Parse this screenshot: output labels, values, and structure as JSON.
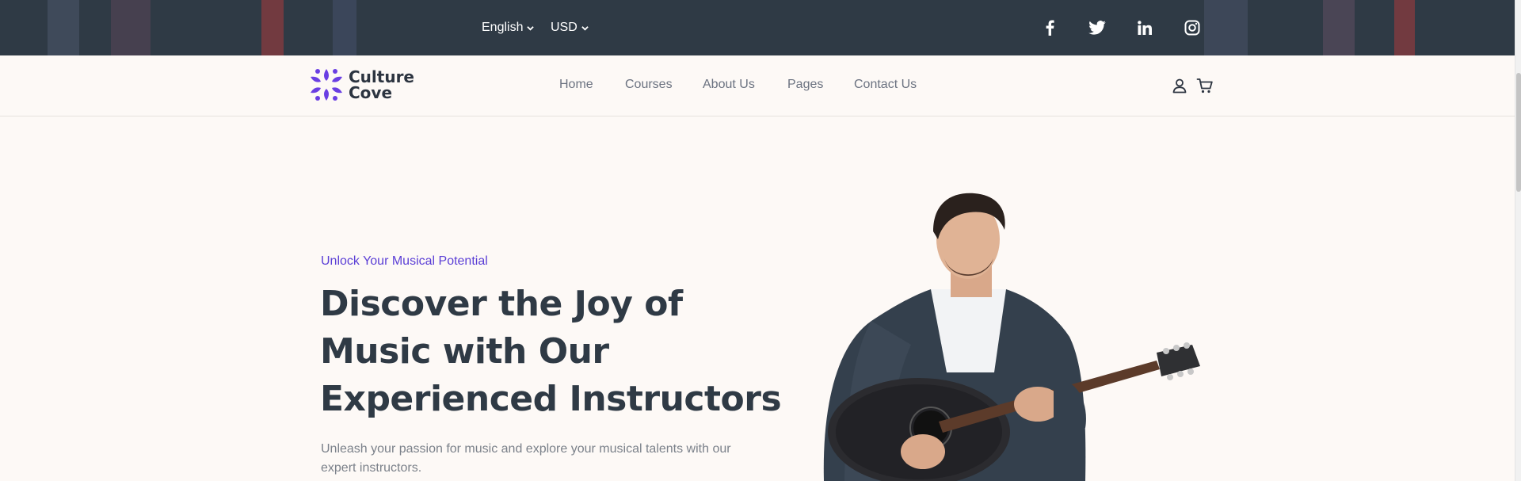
{
  "topbar": {
    "language": "English",
    "currency": "USD",
    "social": [
      {
        "icon": "facebook-icon"
      },
      {
        "icon": "twitter-icon"
      },
      {
        "icon": "linkedin-icon"
      },
      {
        "icon": "instagram-icon"
      }
    ]
  },
  "brand": {
    "line1": "Culture",
    "line2": "Cove",
    "color": "#6a3fe3"
  },
  "nav": {
    "items": [
      "Home",
      "Courses",
      "About Us",
      "Pages",
      "Contact Us"
    ],
    "account_icon": "user-icon",
    "cart_icon": "cart-icon"
  },
  "hero": {
    "kicker": "Unlock Your Musical Potential",
    "title_lines": [
      "Discover the Joy of",
      "Music with Our",
      "Experienced Instructors"
    ],
    "description_lines": [
      "Unleash your passion for music and explore your musical talents with our",
      "expert instructors."
    ],
    "image": "guitarist-photo"
  },
  "colors": {
    "topbar": "#2f3a45",
    "accent": "#5b3fd6",
    "heading": "#2f3a45",
    "background": "#fdf9f6"
  }
}
